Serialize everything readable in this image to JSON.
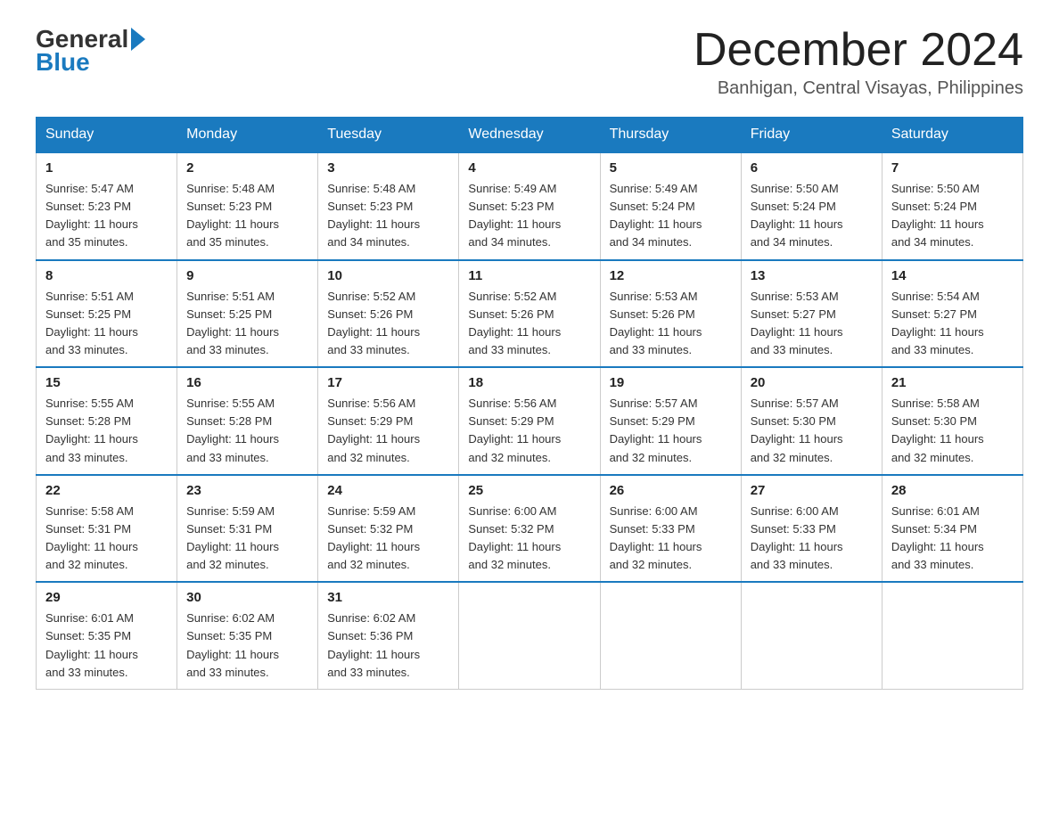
{
  "header": {
    "logo_general": "General",
    "logo_blue": "Blue",
    "month_title": "December 2024",
    "location": "Banhigan, Central Visayas, Philippines"
  },
  "days_of_week": [
    "Sunday",
    "Monday",
    "Tuesday",
    "Wednesday",
    "Thursday",
    "Friday",
    "Saturday"
  ],
  "weeks": [
    [
      {
        "day": "1",
        "sunrise": "5:47 AM",
        "sunset": "5:23 PM",
        "daylight": "11 hours and 35 minutes."
      },
      {
        "day": "2",
        "sunrise": "5:48 AM",
        "sunset": "5:23 PM",
        "daylight": "11 hours and 35 minutes."
      },
      {
        "day": "3",
        "sunrise": "5:48 AM",
        "sunset": "5:23 PM",
        "daylight": "11 hours and 34 minutes."
      },
      {
        "day": "4",
        "sunrise": "5:49 AM",
        "sunset": "5:23 PM",
        "daylight": "11 hours and 34 minutes."
      },
      {
        "day": "5",
        "sunrise": "5:49 AM",
        "sunset": "5:24 PM",
        "daylight": "11 hours and 34 minutes."
      },
      {
        "day": "6",
        "sunrise": "5:50 AM",
        "sunset": "5:24 PM",
        "daylight": "11 hours and 34 minutes."
      },
      {
        "day": "7",
        "sunrise": "5:50 AM",
        "sunset": "5:24 PM",
        "daylight": "11 hours and 34 minutes."
      }
    ],
    [
      {
        "day": "8",
        "sunrise": "5:51 AM",
        "sunset": "5:25 PM",
        "daylight": "11 hours and 33 minutes."
      },
      {
        "day": "9",
        "sunrise": "5:51 AM",
        "sunset": "5:25 PM",
        "daylight": "11 hours and 33 minutes."
      },
      {
        "day": "10",
        "sunrise": "5:52 AM",
        "sunset": "5:26 PM",
        "daylight": "11 hours and 33 minutes."
      },
      {
        "day": "11",
        "sunrise": "5:52 AM",
        "sunset": "5:26 PM",
        "daylight": "11 hours and 33 minutes."
      },
      {
        "day": "12",
        "sunrise": "5:53 AM",
        "sunset": "5:26 PM",
        "daylight": "11 hours and 33 minutes."
      },
      {
        "day": "13",
        "sunrise": "5:53 AM",
        "sunset": "5:27 PM",
        "daylight": "11 hours and 33 minutes."
      },
      {
        "day": "14",
        "sunrise": "5:54 AM",
        "sunset": "5:27 PM",
        "daylight": "11 hours and 33 minutes."
      }
    ],
    [
      {
        "day": "15",
        "sunrise": "5:55 AM",
        "sunset": "5:28 PM",
        "daylight": "11 hours and 33 minutes."
      },
      {
        "day": "16",
        "sunrise": "5:55 AM",
        "sunset": "5:28 PM",
        "daylight": "11 hours and 33 minutes."
      },
      {
        "day": "17",
        "sunrise": "5:56 AM",
        "sunset": "5:29 PM",
        "daylight": "11 hours and 32 minutes."
      },
      {
        "day": "18",
        "sunrise": "5:56 AM",
        "sunset": "5:29 PM",
        "daylight": "11 hours and 32 minutes."
      },
      {
        "day": "19",
        "sunrise": "5:57 AM",
        "sunset": "5:29 PM",
        "daylight": "11 hours and 32 minutes."
      },
      {
        "day": "20",
        "sunrise": "5:57 AM",
        "sunset": "5:30 PM",
        "daylight": "11 hours and 32 minutes."
      },
      {
        "day": "21",
        "sunrise": "5:58 AM",
        "sunset": "5:30 PM",
        "daylight": "11 hours and 32 minutes."
      }
    ],
    [
      {
        "day": "22",
        "sunrise": "5:58 AM",
        "sunset": "5:31 PM",
        "daylight": "11 hours and 32 minutes."
      },
      {
        "day": "23",
        "sunrise": "5:59 AM",
        "sunset": "5:31 PM",
        "daylight": "11 hours and 32 minutes."
      },
      {
        "day": "24",
        "sunrise": "5:59 AM",
        "sunset": "5:32 PM",
        "daylight": "11 hours and 32 minutes."
      },
      {
        "day": "25",
        "sunrise": "6:00 AM",
        "sunset": "5:32 PM",
        "daylight": "11 hours and 32 minutes."
      },
      {
        "day": "26",
        "sunrise": "6:00 AM",
        "sunset": "5:33 PM",
        "daylight": "11 hours and 32 minutes."
      },
      {
        "day": "27",
        "sunrise": "6:00 AM",
        "sunset": "5:33 PM",
        "daylight": "11 hours and 33 minutes."
      },
      {
        "day": "28",
        "sunrise": "6:01 AM",
        "sunset": "5:34 PM",
        "daylight": "11 hours and 33 minutes."
      }
    ],
    [
      {
        "day": "29",
        "sunrise": "6:01 AM",
        "sunset": "5:35 PM",
        "daylight": "11 hours and 33 minutes."
      },
      {
        "day": "30",
        "sunrise": "6:02 AM",
        "sunset": "5:35 PM",
        "daylight": "11 hours and 33 minutes."
      },
      {
        "day": "31",
        "sunrise": "6:02 AM",
        "sunset": "5:36 PM",
        "daylight": "11 hours and 33 minutes."
      },
      null,
      null,
      null,
      null
    ]
  ],
  "labels": {
    "sunrise": "Sunrise:",
    "sunset": "Sunset:",
    "daylight": "Daylight:"
  }
}
